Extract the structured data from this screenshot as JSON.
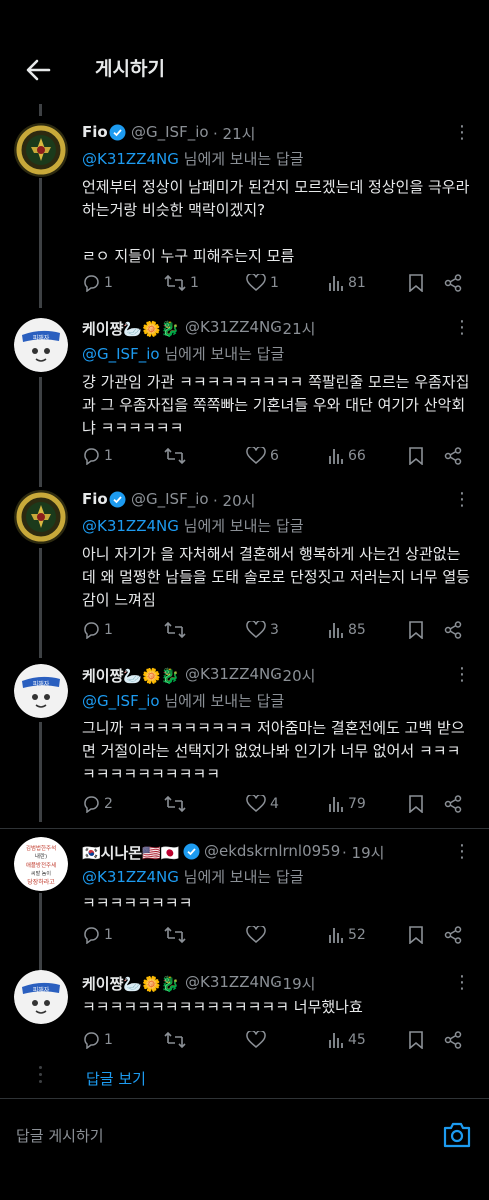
{
  "header": {
    "title": "게시하기"
  },
  "tweets": [
    {
      "name": "Fio",
      "verified": true,
      "handle": "@G_ISF_io",
      "time": "· 21시",
      "reply_mention": "@K31ZZ4NG",
      "reply_suffix": " 님에게 보내는 답글",
      "text": "언제부터 정상이 남페미가 된건지 모르겠는데 정상인을 극우라 하는거랑 비슷한 맥락이겠지?\n\nㄹㅇ 지들이 누구 피해주는지 모름",
      "replies": "1",
      "retweets": "1",
      "likes": "1",
      "views": "81"
    },
    {
      "name": "케이쨩🦢🌼🐉",
      "verified": false,
      "handle": "@K31ZZ4NG",
      "time": "· 21시",
      "reply_mention": "@G_ISF_io",
      "reply_suffix": " 님에게 보내는 답글",
      "text": "걍 가관임 가관 ㅋㅋㅋㅋㅋㅋㅋㅋㅋ 쪽팔린줄 모르는 우좀자집과 그 우좀자집을 쪽쪽빠는 기혼녀들 우와 대단 여기가 산악회냐 ㅋㅋㅋㅋㅋㅋ",
      "replies": "1",
      "retweets": "",
      "likes": "6",
      "views": "66"
    },
    {
      "name": "Fio",
      "verified": true,
      "handle": "@G_ISF_io",
      "time": "· 20시",
      "reply_mention": "@K31ZZ4NG",
      "reply_suffix": " 님에게 보내는 답글",
      "text": "아니 자기가 을 자처해서 결혼해서 행복하게 사는건 상관없는데 왜 멀쩡한 남들을 도태 솔로로 단정짓고 저러는지 너무 열등감이 느껴짐",
      "replies": "1",
      "retweets": "",
      "likes": "3",
      "views": "85"
    },
    {
      "name": "케이쨩🦢🌼🐉",
      "verified": false,
      "handle": "@K31ZZ4NG",
      "time": "· 20시",
      "reply_mention": "@G_ISF_io",
      "reply_suffix": " 님에게 보내는 답글",
      "text": "그니까 ㅋㅋㅋㅋㅋㅋㅋㅋㅋ 저아줌마는 결혼전에도 고백 받으면 거절이라는 선택지가 없었나봐 인기가 너무 없어서 ㅋㅋㅋㅋㅋㅋㅋㅋㅋㅋㅋㅋㅋ",
      "replies": "2",
      "retweets": "",
      "likes": "4",
      "views": "79"
    },
    {
      "name": "🇰🇷시나몬🇺🇸🇯🇵",
      "verified": true,
      "handle": "@ekdskrnlrnl0959",
      "time": "· 19시",
      "reply_mention": "@K31ZZ4NG",
      "reply_suffix": " 님에게 보내는 답글",
      "text": "ㅋㅋㅋㅋㅋㅋㅋㅋ",
      "replies": "1",
      "retweets": "",
      "likes": "",
      "views": "52",
      "avatar_lines": [
        "김범법한주석",
        "내란)",
        "애플방전주세",
        "씨발 놈이",
        "당장하라고"
      ]
    },
    {
      "name": "케이쨩🦢🌼🐉",
      "verified": false,
      "handle": "@K31ZZ4NG",
      "time": "· 19시",
      "text": "ㅋㅋㅋㅋㅋㅋㅋㅋㅋㅋㅋㅋㅋㅋㅋ 너무했나효",
      "replies": "1",
      "retweets": "",
      "likes": "",
      "views": "45"
    }
  ],
  "view_replies": "답글 보기",
  "compose": {
    "placeholder": "답글 게시하기"
  },
  "colors": {
    "accent": "#1d9bf0",
    "muted": "#8b9096",
    "background": "#000000",
    "text": "#e7e9ea"
  }
}
